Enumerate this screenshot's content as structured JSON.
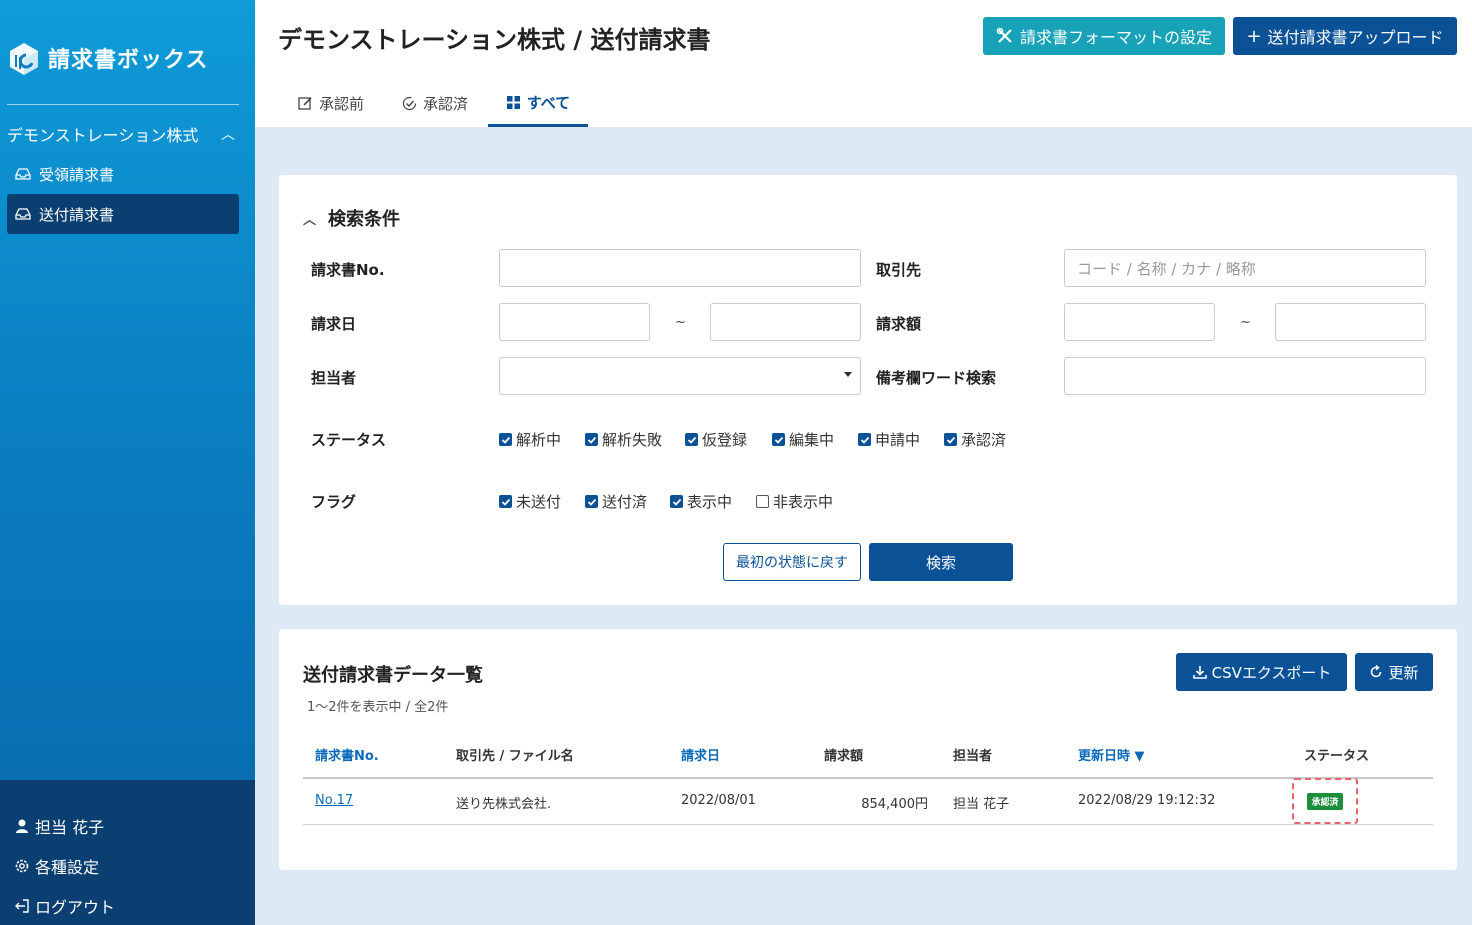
{
  "sidebar": {
    "logo_text": "請求書ボックス",
    "company": "デモンストレーション株式",
    "nav": [
      {
        "label": "受領請求書",
        "icon": "inbox-icon"
      },
      {
        "label": "送付請求書",
        "icon": "inbox-icon"
      }
    ],
    "user": "担当 花子",
    "settings": "各種設定",
    "logout": "ログアウト"
  },
  "header": {
    "title": "デモンストレーション株式 / 送付請求書",
    "format_button": "請求書フォーマットの設定",
    "upload_button": "送付請求書アップロード",
    "tabs": [
      {
        "label": "承認前",
        "icon": "edit-icon"
      },
      {
        "label": "承認済",
        "icon": "check-circle-icon"
      },
      {
        "label": "すべて",
        "icon": "grid-icon"
      }
    ]
  },
  "search": {
    "title": "検索条件",
    "invoice_no_label": "請求書No.",
    "invoice_no_value": "",
    "partner_label": "取引先",
    "partner_placeholder": "コード / 名称 / カナ / 略称",
    "date_label": "請求日",
    "amount_label": "請求額",
    "range_sep": "~",
    "owner_label": "担当者",
    "owner_value": "",
    "memo_label": "備考欄ワード検索",
    "status_label": "ステータス",
    "statuses": [
      {
        "label": "解析中",
        "checked": true
      },
      {
        "label": "解析失敗",
        "checked": true
      },
      {
        "label": "仮登録",
        "checked": true
      },
      {
        "label": "編集中",
        "checked": true
      },
      {
        "label": "申請中",
        "checked": true
      },
      {
        "label": "承認済",
        "checked": true
      }
    ],
    "flag_label": "フラグ",
    "flags": [
      {
        "label": "未送付",
        "checked": true
      },
      {
        "label": "送付済",
        "checked": true
      },
      {
        "label": "表示中",
        "checked": true
      },
      {
        "label": "非表示中",
        "checked": false
      }
    ],
    "reset_button": "最初の状態に戻す",
    "search_button": "検索"
  },
  "list": {
    "title": "送付請求書データ一覧",
    "count_text": "1〜2件を表示中 / 全2件",
    "csv_button": "CSVエクスポート",
    "refresh_button": "更新",
    "columns": [
      "請求書No.",
      "取引先 / ファイル名",
      "請求日",
      "請求額",
      "担当者",
      "更新日時 ▼",
      "ステータス"
    ],
    "rows": [
      {
        "no": "No.17",
        "partner": "送り先株式会社.",
        "date": "2022/08/01",
        "amount": "854,400円",
        "owner": "担当 花子",
        "updated": "2022/08/29 19:12:32",
        "status": "承認済"
      }
    ]
  },
  "colors": {
    "primary": "#0a5196",
    "teal": "#17a2b8",
    "success": "#1d8f3a"
  }
}
